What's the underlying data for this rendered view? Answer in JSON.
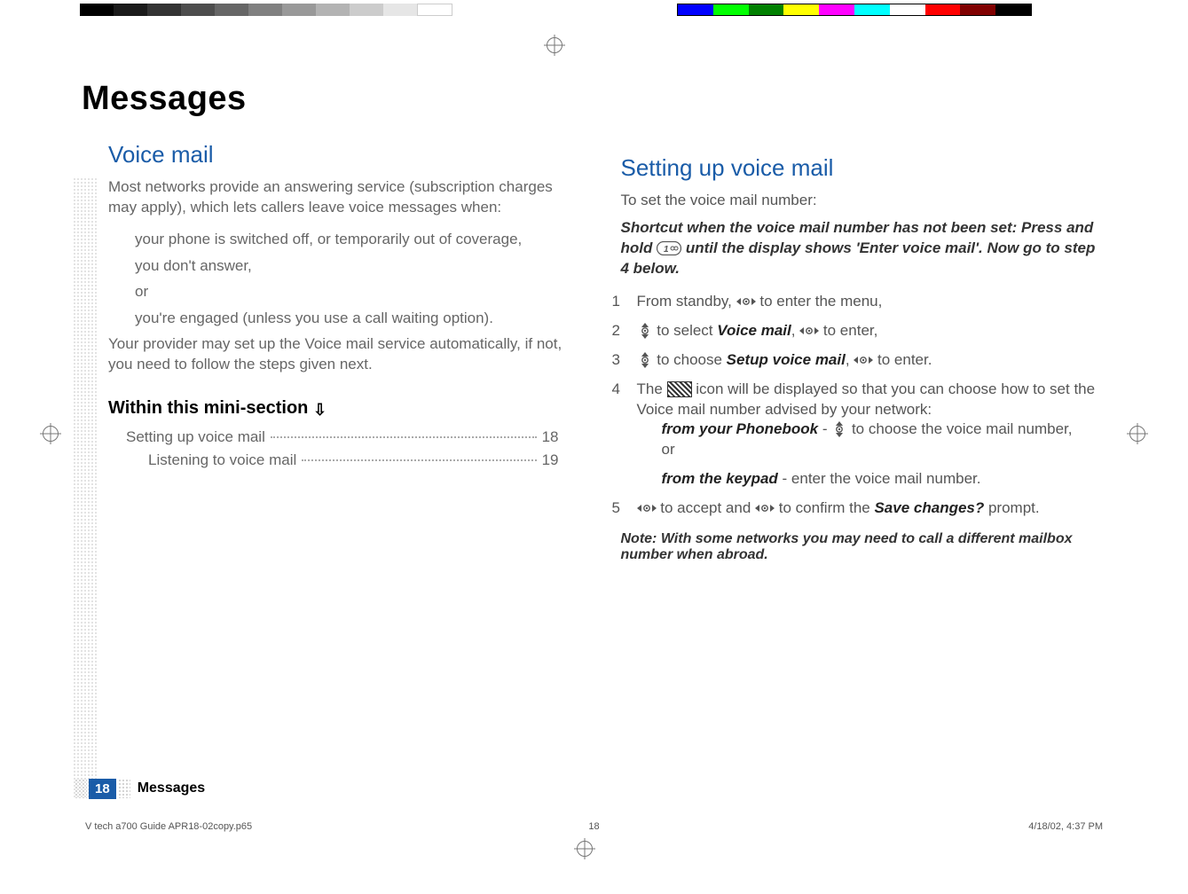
{
  "header": {
    "title": "Messages"
  },
  "left": {
    "section_title": "Voice mail",
    "intro": "Most networks provide an answering service (subscription charges may apply), which lets callers leave voice messages when:",
    "bullets": [
      "your phone is switched off, or temporarily out of coverage,",
      "you don't answer,",
      "or",
      "you're engaged (unless you use a call waiting option)."
    ],
    "after": "Your provider may set up the Voice mail service automatically, if not, you need to follow the steps given next.",
    "mini_head": "Within this mini-section",
    "toc": [
      {
        "label": "Setting up voice mail",
        "page": "18",
        "sub": false
      },
      {
        "label": "Listening to voice mail",
        "page": "19",
        "sub": true
      }
    ]
  },
  "right": {
    "section_title": "Setting up voice mail",
    "intro": "To set the voice mail number:",
    "shortcut_a": "Shortcut when the voice mail number has not been set: Press and hold ",
    "shortcut_b": " until the display shows 'Enter voice mail'. Now go to step 4 below.",
    "steps": {
      "s1a": "From standby, ",
      "s1b": " to enter the menu,",
      "s2a": " to select ",
      "s2_vm": "Voice mail",
      "s2b": ", ",
      "s2c": " to enter,",
      "s3a": " to choose ",
      "s3_setup": "Setup voice mail",
      "s3b": ", ",
      "s3c": " to enter.",
      "s4a": "The ",
      "s4b": " icon will be displayed so that you can choose how to set the Voice mail number advised by your network:",
      "s4_pb_head": "from your Phonebook",
      "s4_pb_tail": " - ",
      "s4_pb_end": " to choose the voice mail number,",
      "s4_or": "or",
      "s4_kp_head": "from the keypad",
      "s4_kp_tail": " - enter the voice mail number.",
      "s5a": " to accept and ",
      "s5b": " to confirm the ",
      "s5_save": "Save changes?",
      "s5c": " prompt."
    },
    "note": "Note: With some networks you may need to call a different mailbox number when abroad."
  },
  "footer": {
    "page_num": "18",
    "label": "Messages",
    "file": "V tech a700 Guide APR18-02copy.p65",
    "sheet": "18",
    "timestamp": "4/18/02, 4:37 PM"
  }
}
